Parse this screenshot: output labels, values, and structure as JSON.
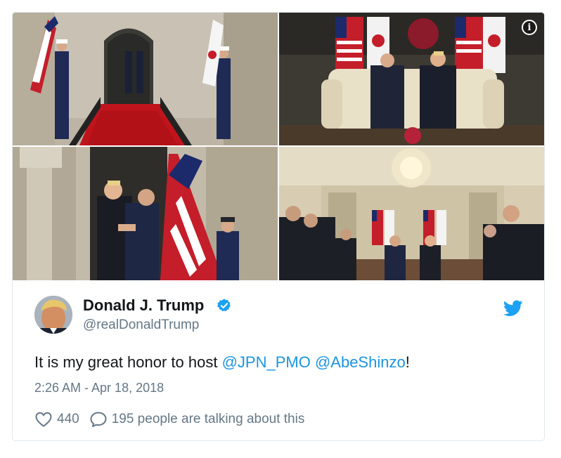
{
  "tweet": {
    "display_name": "Donald J. Trump",
    "handle": "@realDonaldTrump",
    "text_before": "It is my great honor to host ",
    "mention_1": "@JPN_PMO",
    "text_between": " ",
    "mention_2": "@AbeShinzo",
    "text_after": "!",
    "timestamp": "2:26 AM - Apr 18, 2018",
    "likes": "440",
    "talking": "195 people are talking about this"
  },
  "media": {
    "info_glyph": "i",
    "photos": [
      "staircase-guards-photo",
      "sofa-handshake-photo",
      "doorway-handshake-photo",
      "meeting-room-photo"
    ]
  },
  "colors": {
    "link": "#1b95e0",
    "secondary_text": "#657786",
    "verified": "#1da1f2",
    "twitter_bird": "#1da1f2",
    "border": "#e1e8ed"
  },
  "icons": {
    "verified": "verified-badge-icon",
    "bird": "twitter-bird-icon",
    "like": "heart-icon",
    "reply": "speech-bubble-icon",
    "info": "info-icon"
  }
}
